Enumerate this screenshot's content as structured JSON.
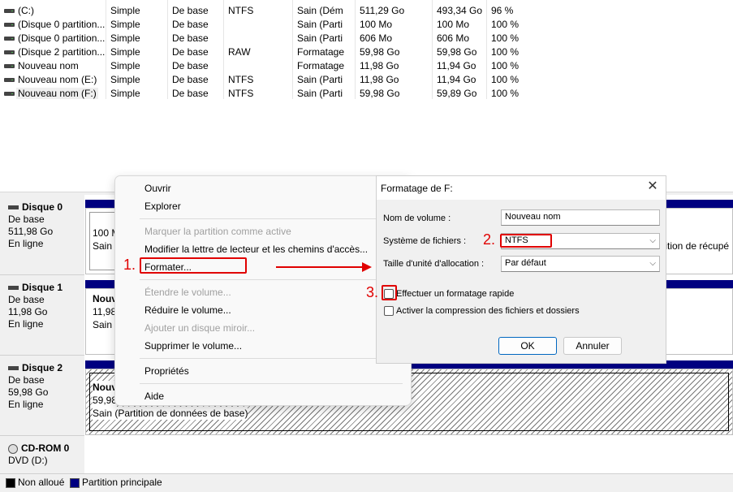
{
  "volumes": [
    {
      "name": "(C:)",
      "layout": "Simple",
      "type": "De base",
      "fs": "NTFS",
      "status": "Sain (Dém",
      "capacity": "511,29 Go",
      "free": "493,34 Go",
      "pct": "96 %"
    },
    {
      "name": "(Disque 0 partition...",
      "layout": "Simple",
      "type": "De base",
      "fs": "",
      "status": "Sain (Parti",
      "capacity": "100 Mo",
      "free": "100 Mo",
      "pct": "100 %"
    },
    {
      "name": "(Disque 0 partition...",
      "layout": "Simple",
      "type": "De base",
      "fs": "",
      "status": "Sain (Parti",
      "capacity": "606 Mo",
      "free": "606 Mo",
      "pct": "100 %"
    },
    {
      "name": "(Disque 2 partition...",
      "layout": "Simple",
      "type": "De base",
      "fs": "RAW",
      "status": "Formatage",
      "capacity": "59,98 Go",
      "free": "59,98 Go",
      "pct": "100 %"
    },
    {
      "name": "Nouveau nom",
      "layout": "Simple",
      "type": "De base",
      "fs": "",
      "status": "Formatage",
      "capacity": "11,98 Go",
      "free": "11,94 Go",
      "pct": "100 %"
    },
    {
      "name": "Nouveau nom (E:)",
      "layout": "Simple",
      "type": "De base",
      "fs": "NTFS",
      "status": "Sain (Parti",
      "capacity": "11,98 Go",
      "free": "11,94 Go",
      "pct": "100 %"
    },
    {
      "name": "Nouveau nom (F:)",
      "layout": "Simple",
      "type": "De base",
      "fs": "NTFS",
      "status": "Sain (Parti",
      "capacity": "59,98 Go",
      "free": "59,89 Go",
      "pct": "100 %"
    }
  ],
  "disks": [
    {
      "name": "Disque 0",
      "type": "De base",
      "size": "511,98 Go",
      "state": "En ligne",
      "part_line1": "100 M",
      "part_line2": "Sain (",
      "right_text": "tition de récupé"
    },
    {
      "name": "Disque 1",
      "type": "De base",
      "size": "11,98 Go",
      "state": "En ligne",
      "part_line1": "Nouv",
      "part_line2": "11,98",
      "part_line3": "Sain ("
    },
    {
      "name": "Disque 2",
      "type": "De base",
      "size": "59,98 Go",
      "state": "En ligne",
      "part_line1": "Nouv",
      "part_line2": "59,98",
      "part_line3": "Sain (Partition de données de base)"
    },
    {
      "name": "CD-ROM 0",
      "type": "DVD (D:)"
    }
  ],
  "legend": {
    "unallocated": "Non alloué",
    "primary": "Partition principale",
    "unallocated_color": "#000000",
    "primary_color": "#000080"
  },
  "context_menu": {
    "open": "Ouvrir",
    "explore": "Explorer",
    "mark_active": "Marquer la partition comme active",
    "change_letter": "Modifier la lettre de lecteur et les chemins d'accès...",
    "format": "Formater...",
    "extend": "Étendre le volume...",
    "shrink": "Réduire le volume...",
    "add_mirror": "Ajouter un disque miroir...",
    "delete": "Supprimer le volume...",
    "properties": "Propriétés",
    "help": "Aide"
  },
  "dialog": {
    "title": "Formatage de F:",
    "volume_label_label": "Nom de volume :",
    "volume_label_value": "Nouveau nom",
    "fs_label": "Système de fichiers :",
    "fs_value": "NTFS",
    "alloc_label": "Taille d'unité d'allocation :",
    "alloc_value": "Par défaut",
    "quick_format": "Effectuer un formatage rapide",
    "compression": "Activer la compression des fichiers et dossiers",
    "ok": "OK",
    "cancel": "Annuler"
  },
  "annotations": {
    "step1": "1.",
    "step2": "2.",
    "step3": "3.",
    "color": "#e00000"
  }
}
